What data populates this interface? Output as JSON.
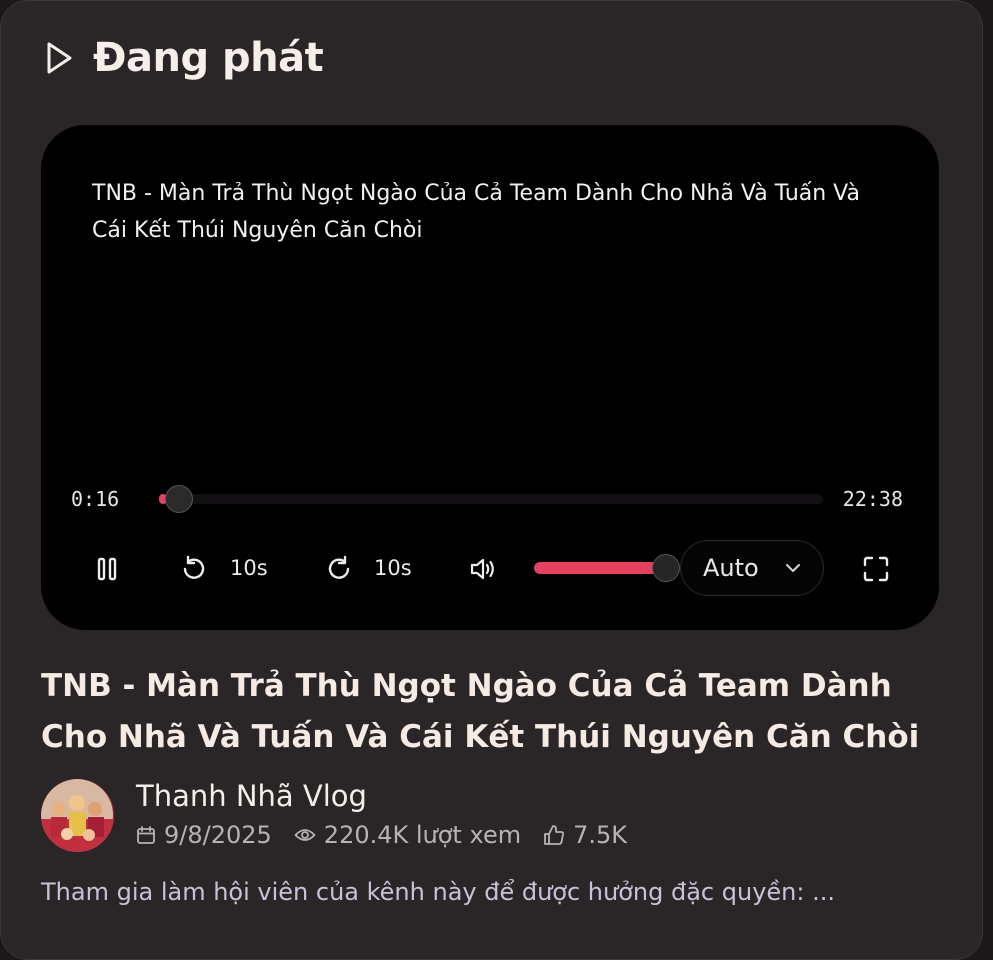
{
  "header": {
    "title": "Đang phát",
    "icon": "play-outline-icon"
  },
  "player": {
    "overlay_title": "TNB - Màn Trả Thù Ngọt Ngào Của Cả Team Dành Cho Nhã Và Tuấn Và Cái Kết Thúi Nguyên Căn Chòi",
    "current_time": "0:16",
    "total_time": "22:38",
    "progress_fraction": 0.012,
    "skip_back_label": "10s",
    "skip_forward_label": "10s",
    "volume_fraction": 1.0,
    "quality": "Auto",
    "accent_color": "#e4405f"
  },
  "video": {
    "title": "TNB - Màn Trả Thù Ngọt Ngào Của Cả Team Dành Cho Nhã Và Tuấn Và Cái Kết Thúi Nguyên Căn Chòi",
    "channel": "Thanh Nhã Vlog",
    "date": "9/8/2025",
    "views": "220.4K lượt xem",
    "likes": "7.5K",
    "description": "Tham gia làm hội viên của kênh này để được hưởng đặc quyền: ..."
  }
}
